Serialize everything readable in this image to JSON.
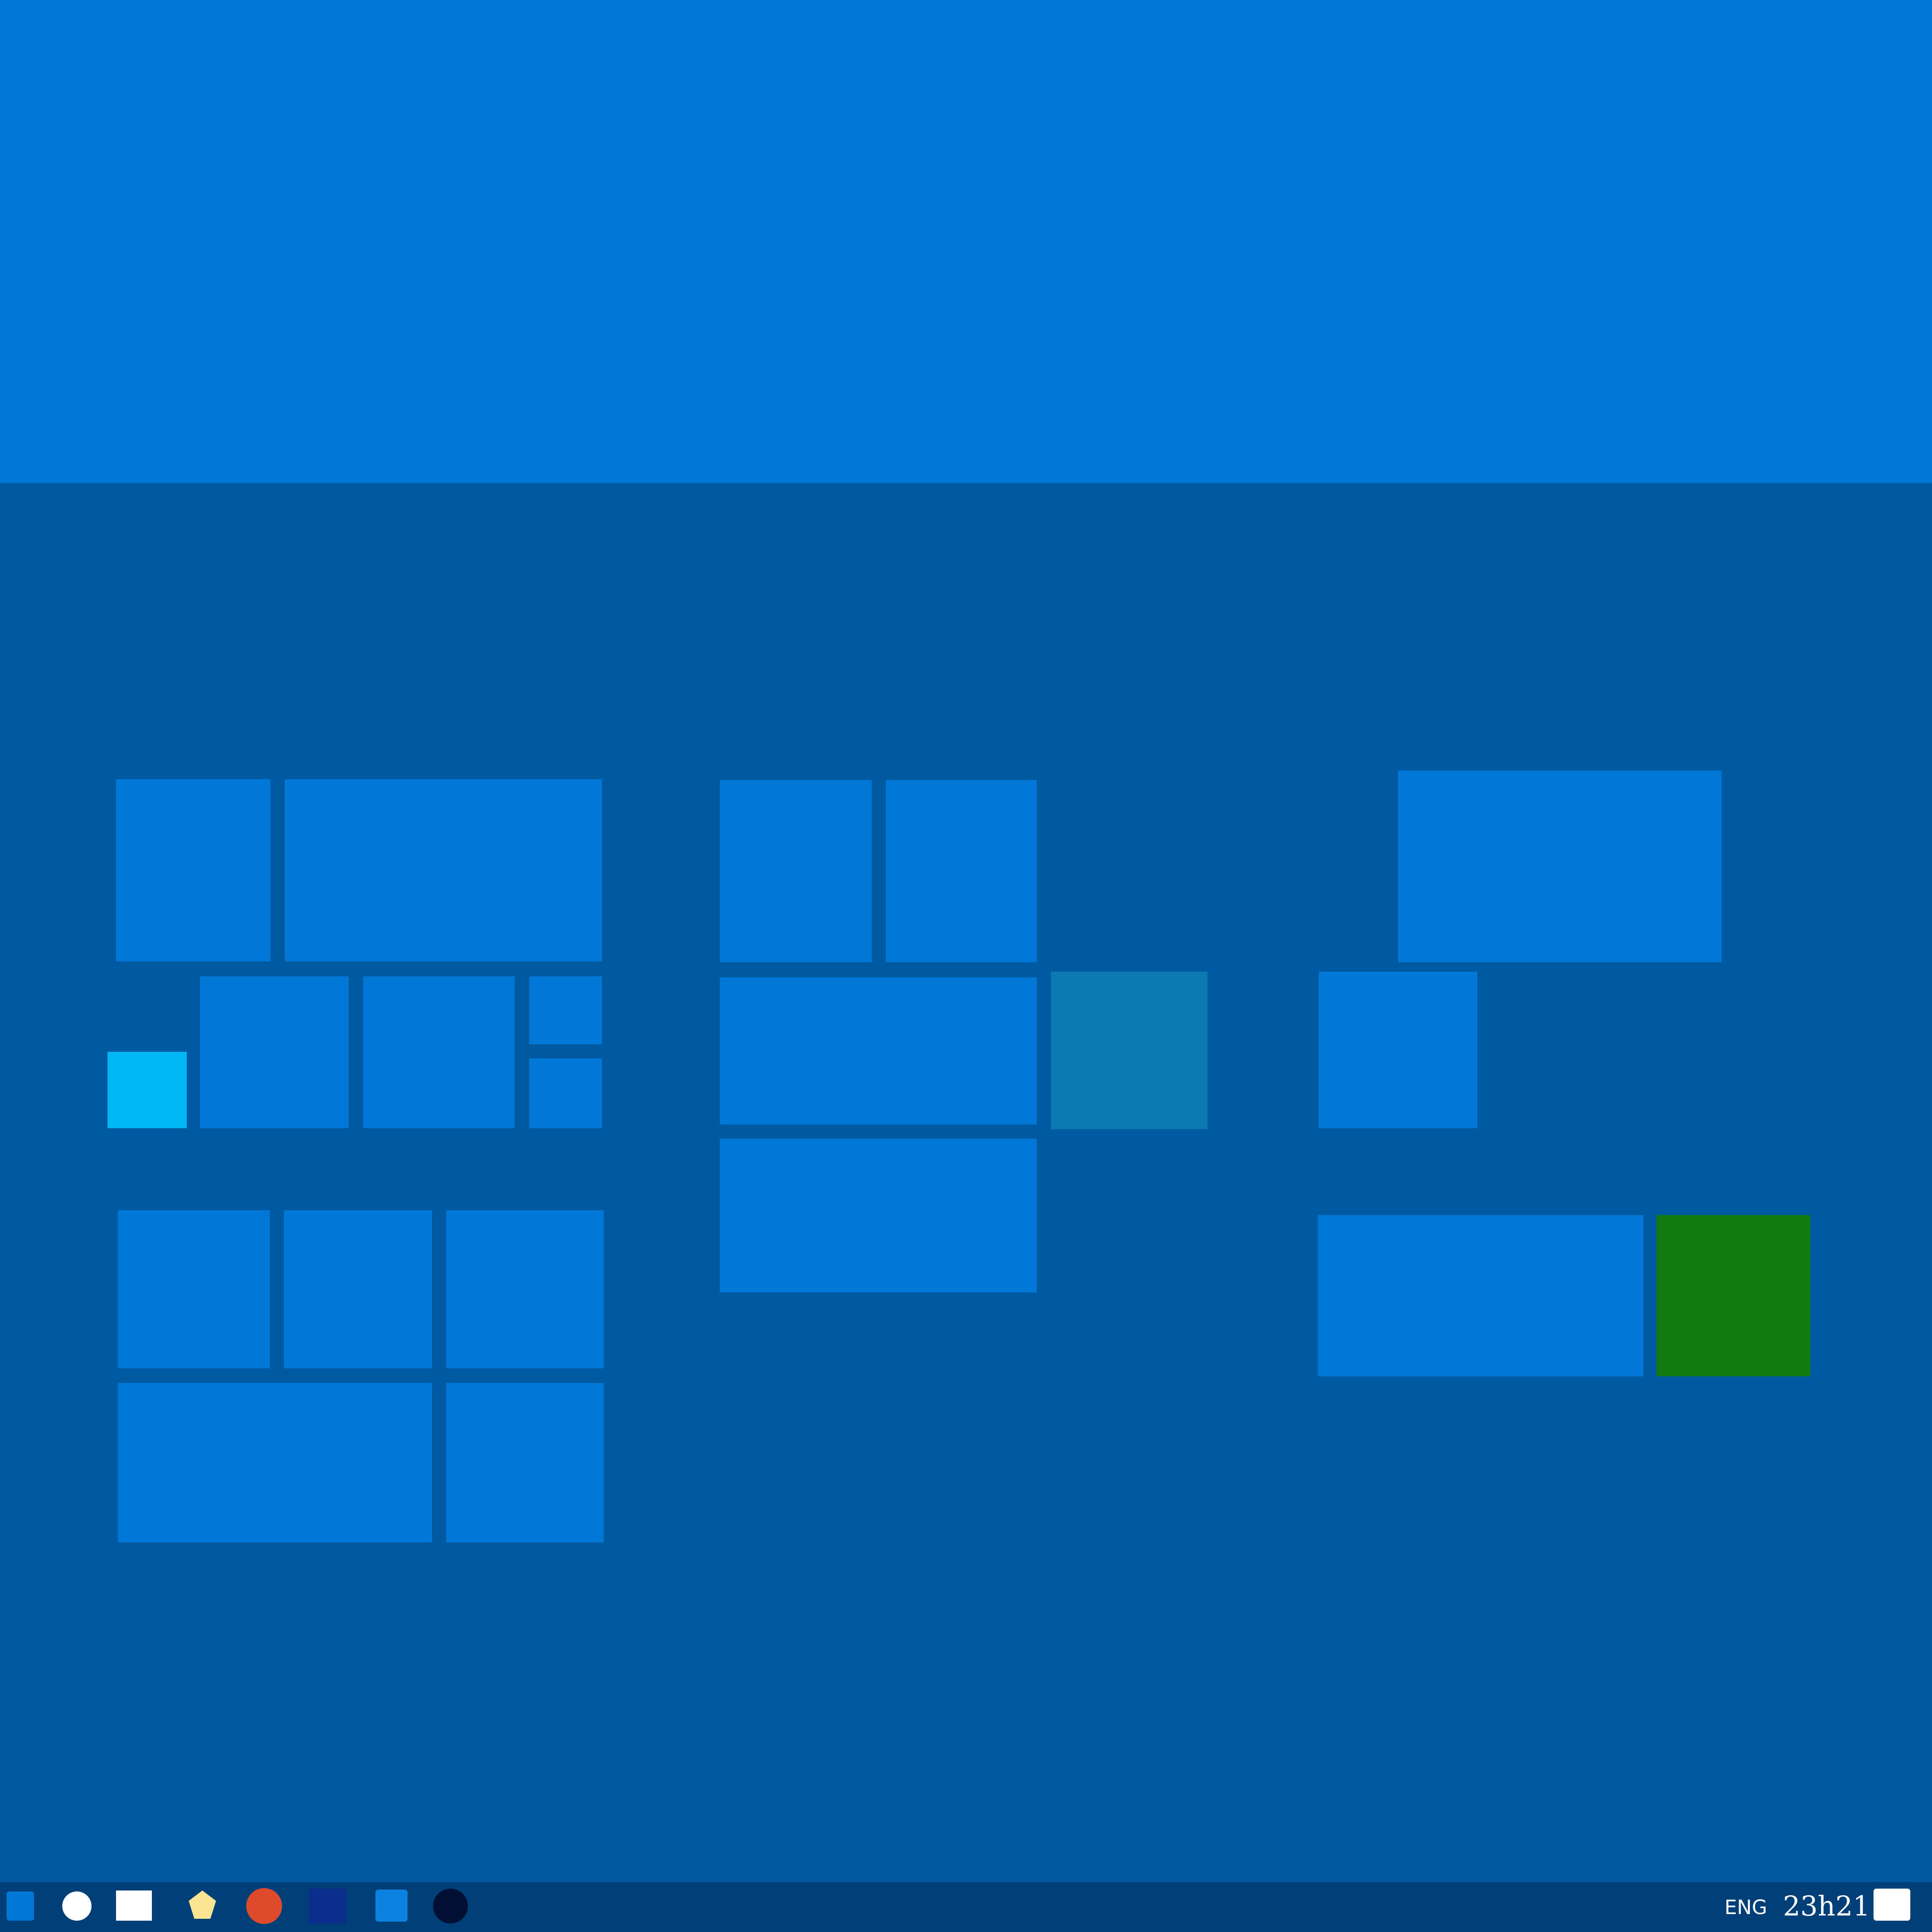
{
  "colors": {
    "top_band": "#0078d7",
    "start_background": "#005aa1",
    "tile": "#0078d7",
    "tile_light_blue": "#00b7f5",
    "tile_teal": "#0b7ab3",
    "tile_green": "#117a10",
    "taskbar": "#003f78",
    "taskbar_dark_blue": "#0b2e8d",
    "taskbar_navy": "#000f33",
    "taskbar_orange": "#de4a2a",
    "taskbar_yellow": "#fbe593"
  },
  "taskbar": {
    "apps": [
      {
        "icon": "start-icon"
      },
      {
        "icon": "search-icon"
      },
      {
        "icon": "task-view-icon"
      },
      {
        "icon": "pentagon-app-icon"
      },
      {
        "icon": "circle-app-icon"
      },
      {
        "icon": "dark-square-app-icon"
      },
      {
        "icon": "blue-app-icon"
      },
      {
        "icon": "navy-circle-app-icon"
      }
    ],
    "language": "ENG",
    "clock": "23h21",
    "notifications_icon": "notification-icon"
  }
}
